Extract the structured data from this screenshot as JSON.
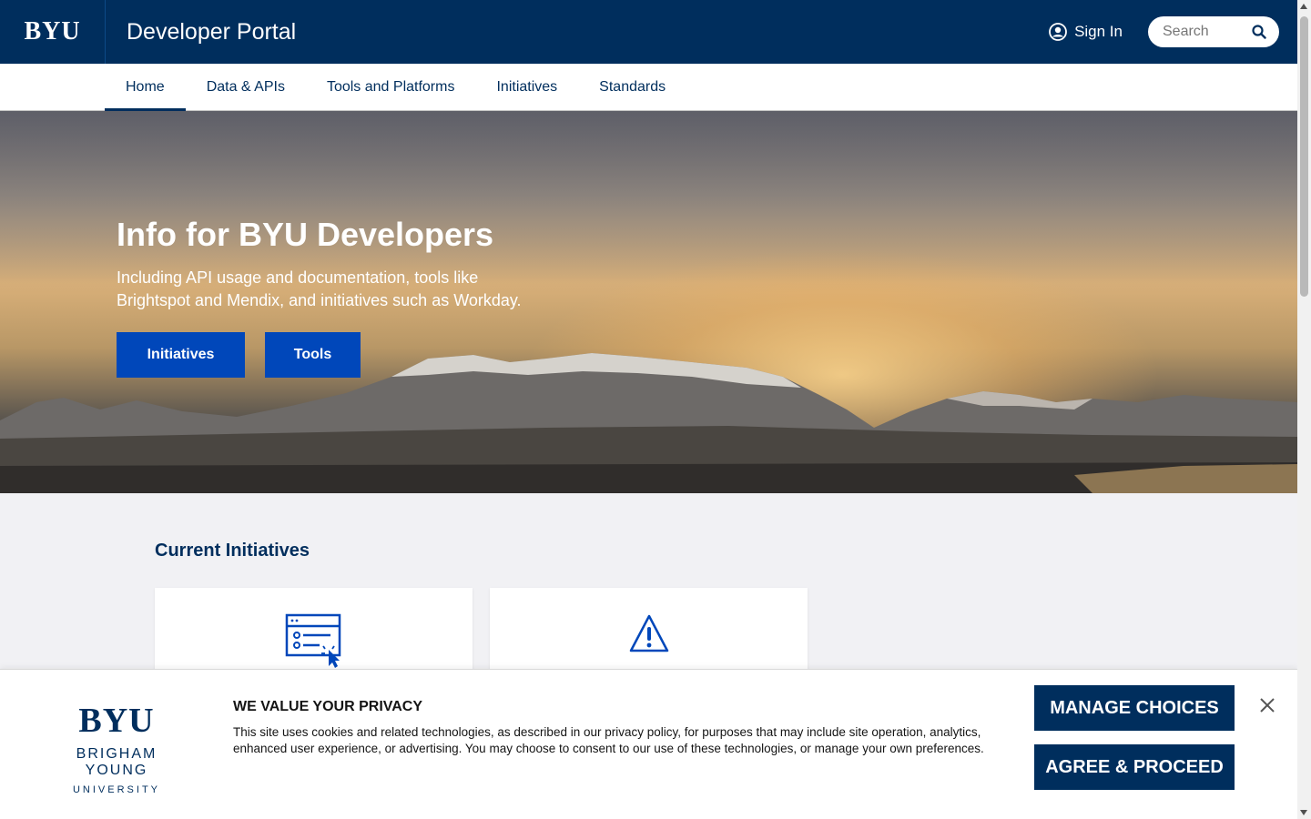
{
  "header": {
    "logo": "BYU",
    "site_title": "Developer Portal",
    "sign_in": "Sign In",
    "search_placeholder": "Search"
  },
  "nav": {
    "items": [
      {
        "label": "Home",
        "active": true
      },
      {
        "label": "Data & APIs"
      },
      {
        "label": "Tools and Platforms"
      },
      {
        "label": "Initiatives"
      },
      {
        "label": "Standards"
      }
    ]
  },
  "hero": {
    "title": "Info for BYU Developers",
    "subtitle": "Including API usage and documentation, tools like Brightspot and Mendix, and initiatives such as Workday.",
    "buttons": [
      "Initiatives",
      "Tools"
    ]
  },
  "main": {
    "section_title": "Current Initiatives",
    "cards": [
      {
        "icon": "web-form-click-icon"
      },
      {
        "icon": "warning-triangle-icon"
      }
    ]
  },
  "privacy": {
    "logo_mark": "BYU",
    "logo_line1": "BRIGHAM YOUNG",
    "logo_line2": "UNIVERSITY",
    "title": "WE VALUE YOUR PRIVACY",
    "body": "This site uses cookies and related technologies, as described in our privacy policy, for purposes that may include site operation, analytics, enhanced user experience, or advertising. You may choose to consent to our use of these technologies, or manage your own preferences.",
    "manage_label": "MANAGE CHOICES",
    "agree_label": "AGREE & PROCEED"
  },
  "colors": {
    "navy": "#002e5d",
    "royal": "#0047ba",
    "page_bg": "#f1f1f4"
  }
}
